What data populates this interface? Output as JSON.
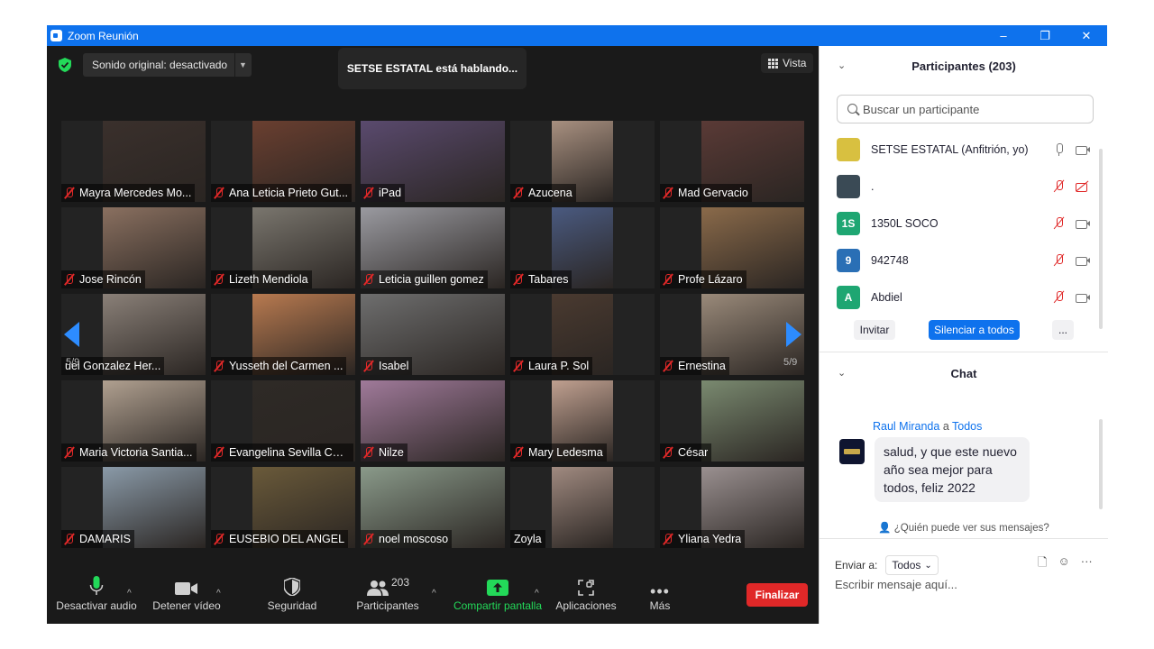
{
  "window": {
    "title": "Zoom Reunión",
    "controls": [
      "–",
      "❐",
      "✕"
    ]
  },
  "top_bar": {
    "sound": "Sonido original: desactivado",
    "speaking": "SETSE ESTATAL está hablando...",
    "view": "Vista"
  },
  "gallery": {
    "page_indicator": "5/9",
    "tiles": [
      {
        "name": "Mayra Mercedes Mo...",
        "muted": true,
        "bg": "#3a302c"
      },
      {
        "name": "Ana Leticia Prieto Gut...",
        "muted": true,
        "bg": "#6a3f30"
      },
      {
        "name": "iPad",
        "muted": true,
        "bg": "#5a4a6e"
      },
      {
        "name": "Azucena",
        "muted": true,
        "bg": "#a89080"
      },
      {
        "name": "Mad Gervacio",
        "muted": true,
        "bg": "#5a3a36"
      },
      {
        "name": "Jose Rincón",
        "muted": true,
        "bg": "#8a7060"
      },
      {
        "name": "Lizeth Mendiola",
        "muted": true,
        "bg": "#7a766e"
      },
      {
        "name": "Leticia guillen gomez",
        "muted": true,
        "bg": "#9a9aa0"
      },
      {
        "name": "Tabares",
        "muted": true,
        "bg": "#4a5a80"
      },
      {
        "name": "Profe Lázaro",
        "muted": true,
        "bg": "#8a6a4a"
      },
      {
        "name": "uel Gonzalez Her...",
        "muted": false,
        "bg": "#8a8078"
      },
      {
        "name": "Yusseth del Carmen ...",
        "muted": true,
        "bg": "#b87a50"
      },
      {
        "name": "Isabel",
        "muted": true,
        "bg": "#6e6e6e"
      },
      {
        "name": "Laura P. Sol",
        "muted": true,
        "bg": "#4a3a30"
      },
      {
        "name": "Ernestina",
        "muted": true,
        "bg": "#9a8a7a"
      },
      {
        "name": "Maria Victoria Santia...",
        "muted": true,
        "bg": "#b0a090"
      },
      {
        "name": "Evangelina Sevilla Cel...",
        "muted": true,
        "bg": "#2e2a26"
      },
      {
        "name": "Nilze",
        "muted": true,
        "bg": "#a07a9a"
      },
      {
        "name": "Mary Ledesma",
        "muted": true,
        "bg": "#c0a090"
      },
      {
        "name": "César",
        "muted": true,
        "bg": "#7a8a70"
      },
      {
        "name": "DAMARIS",
        "muted": true,
        "bg": "#8a9aa8"
      },
      {
        "name": "EUSEBIO DEL ANGEL",
        "muted": true,
        "bg": "#6a5a3a"
      },
      {
        "name": "noel moscoso",
        "muted": true,
        "bg": "#8a9a8a"
      },
      {
        "name": "Zoyla",
        "muted": false,
        "bg": "#a08a80"
      },
      {
        "name": "Yliana Yedra",
        "muted": true,
        "bg": "#9a9090"
      }
    ]
  },
  "toolbar": {
    "audio": "Desactivar audio",
    "video": "Detener vídeo",
    "security": "Seguridad",
    "participants_count": "203",
    "participants": "Participantes",
    "share": "Compartir pantalla",
    "apps": "Aplicaciones",
    "more": "Más",
    "end": "Finalizar"
  },
  "participants_panel": {
    "title": "Participantes (203)",
    "search_placeholder": "Buscar un participante",
    "list": [
      {
        "initials": "",
        "name": "SETSE ESTATAL (Anfitrión, yo)",
        "color": "#d8c040",
        "mic": "on",
        "cam": "on"
      },
      {
        "initials": "",
        "name": ".",
        "color": "#3a4a55",
        "mic": "off",
        "cam": "off"
      },
      {
        "initials": "1S",
        "name": "1350L SOCO",
        "color": "#1ea672",
        "mic": "off",
        "cam": "on"
      },
      {
        "initials": "9",
        "name": "942748",
        "color": "#2a6fb5",
        "mic": "off",
        "cam": "on"
      },
      {
        "initials": "A",
        "name": "Abdiel",
        "color": "#1ea672",
        "mic": "off",
        "cam": "on"
      }
    ],
    "invite": "Invitar",
    "mute_all": "Silenciar a todos",
    "more": "..."
  },
  "chat": {
    "title": "Chat",
    "sender": "Raul Miranda",
    "to_word": "a",
    "recipient": "Todos",
    "message": "salud, y que este nuevo año sea mejor para todos, feliz 2022",
    "who_can_see": "¿Quién puede ver sus mensajes?",
    "send_to_label": "Enviar a:",
    "send_to_value": "Todos",
    "input_placeholder": "Escribir mensaje aquí..."
  },
  "colors": {
    "accent": "#0e72ed",
    "end": "#e02828",
    "share": "#23d959",
    "muted": "#e02828"
  }
}
